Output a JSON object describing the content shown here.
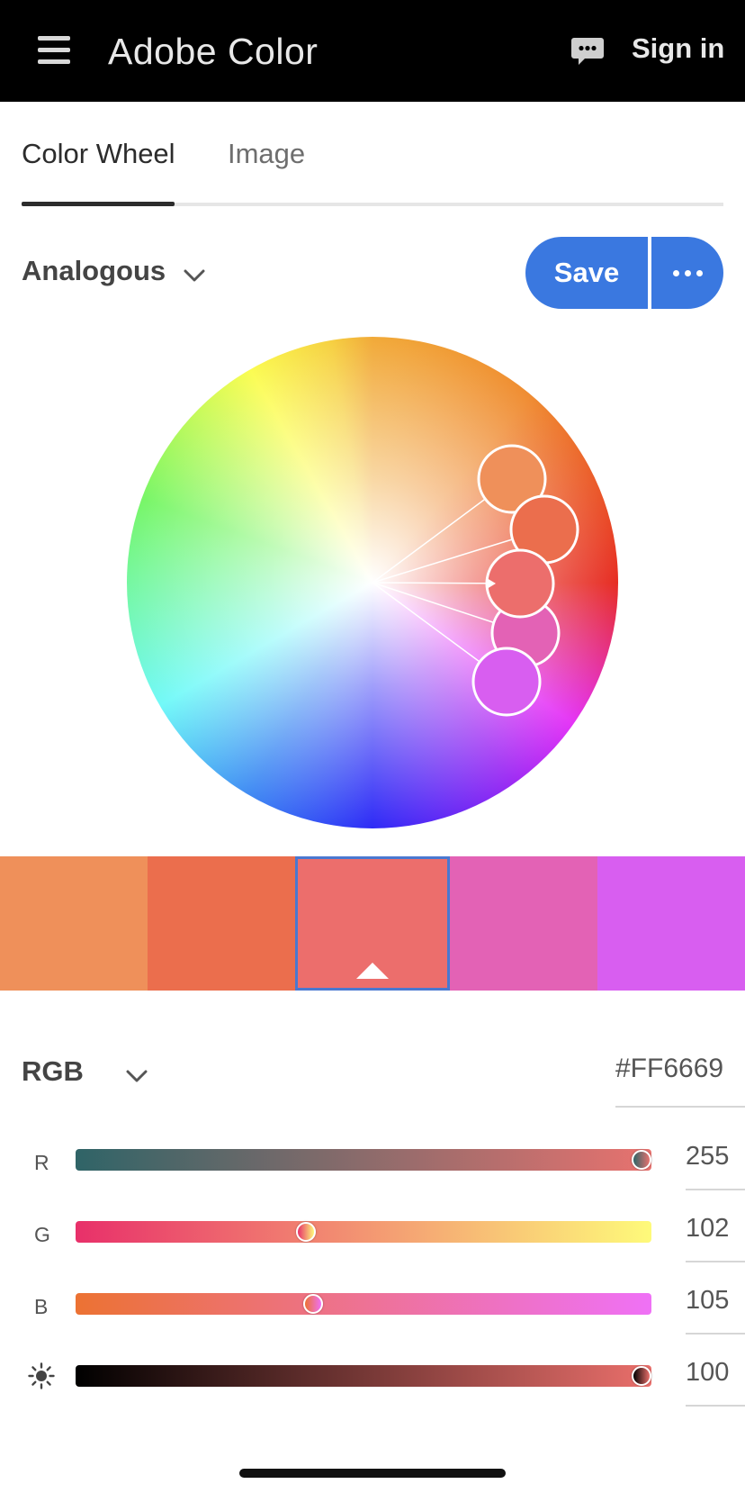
{
  "header": {
    "title": "Adobe Color",
    "signin_label": "Sign in",
    "menu_icon": "hamburger-menu-icon",
    "chat_icon": "chat-bubble-icon"
  },
  "tabs": [
    {
      "label": "Color Wheel",
      "active": true
    },
    {
      "label": "Image",
      "active": false
    }
  ],
  "harmony": {
    "rule": "Analogous",
    "save_label": "Save",
    "more_icon": "ellipsis-icon"
  },
  "palette": {
    "selected_index": 2,
    "swatches": [
      {
        "color": "#EF905A"
      },
      {
        "color": "#EB6E4D"
      },
      {
        "color": "#EC6E6C"
      },
      {
        "color": "#E362B5"
      },
      {
        "color": "#D85EF0"
      }
    ]
  },
  "color_mode": {
    "mode": "RGB",
    "hex": "#FF6669"
  },
  "sliders": [
    {
      "label": "R",
      "value": "255",
      "fraction": 1.0,
      "gradient": [
        "#2f6467",
        "#e8726f"
      ]
    },
    {
      "label": "G",
      "value": "102",
      "fraction": 0.4,
      "gradient": [
        "#e8306a",
        "#fefa7a"
      ]
    },
    {
      "label": "B",
      "value": "105",
      "fraction": 0.412,
      "gradient": [
        "#ec7233",
        "#ef71f6"
      ]
    },
    {
      "label": "",
      "icon": "brightness-icon",
      "value": "100",
      "fraction": 1.0,
      "gradient": [
        "#000000",
        "#ea6f6b"
      ]
    }
  ]
}
